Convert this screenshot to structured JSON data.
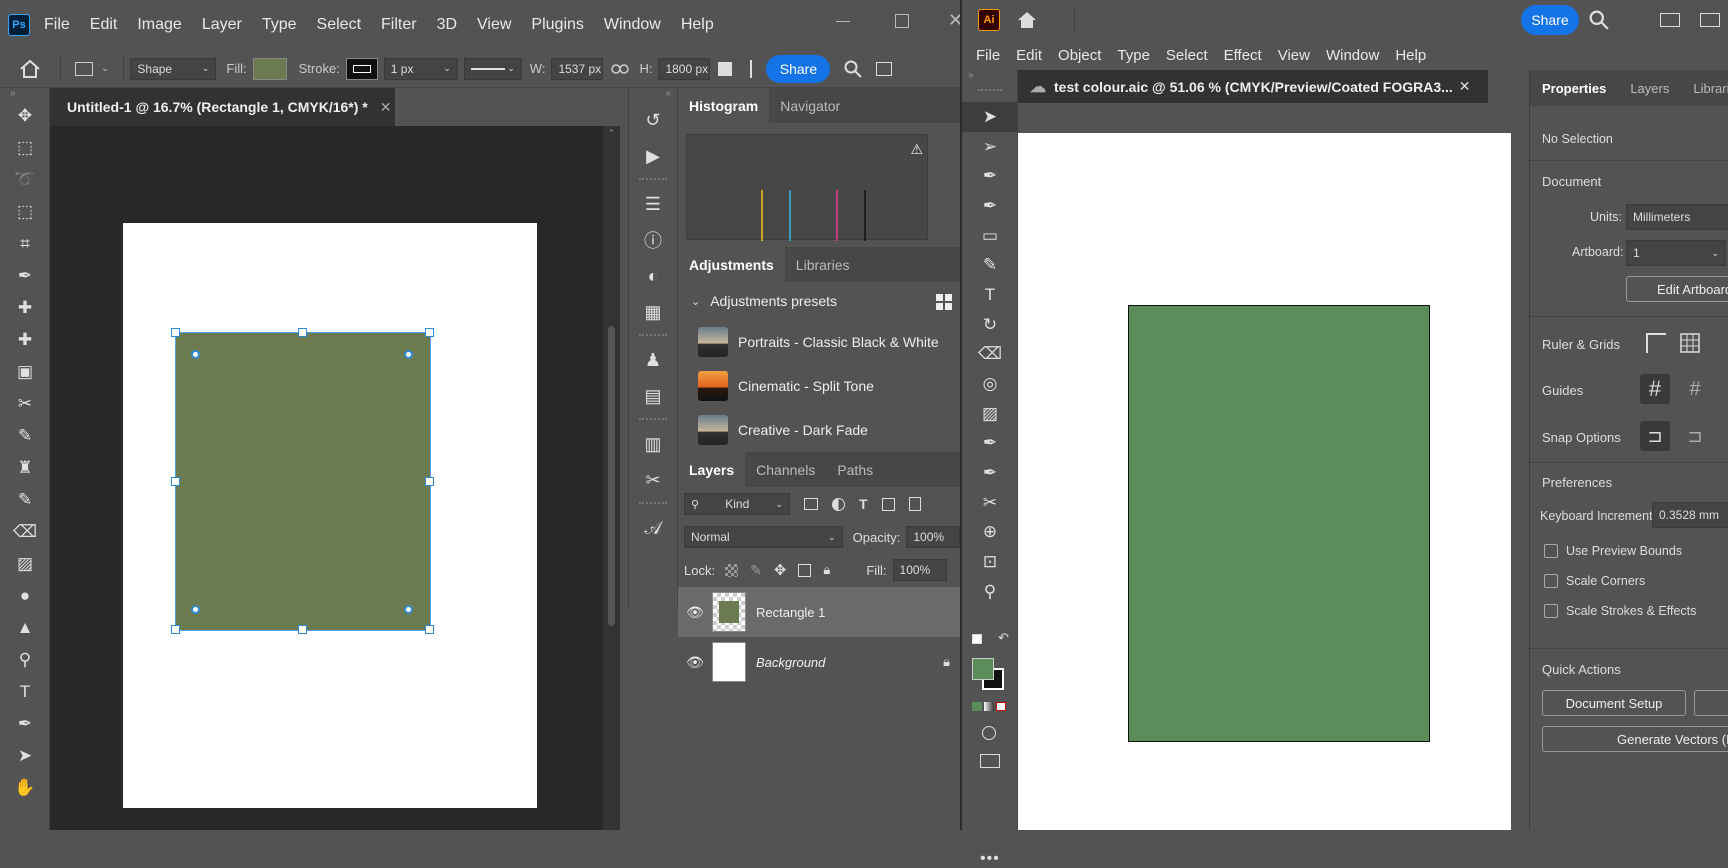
{
  "colors": {
    "ps_fill": "#6b7a4f",
    "ai_fill": "#5a8d5a",
    "accent": "#1473e6",
    "selection": "#2f8ad6",
    "ps_logo": "#31a8ff",
    "ai_logo": "#ff9a00"
  },
  "photoshop": {
    "logo": "Ps",
    "menu": [
      "File",
      "Edit",
      "Image",
      "Layer",
      "Type",
      "Select",
      "Filter",
      "3D",
      "View",
      "Plugins",
      "Window",
      "Help"
    ],
    "options": {
      "mode": "Shape",
      "fill_label": "Fill:",
      "stroke_label": "Stroke:",
      "stroke_width": "1 px",
      "w_label": "W:",
      "w_value": "1537 px",
      "h_label": "H:",
      "h_value": "1800 px",
      "share": "Share"
    },
    "tools": [
      "move-tool-icon",
      "marquee-tool-icon",
      "lasso-tool-icon",
      "object-select-icon",
      "crop-tool-icon",
      "eyedropper-icon",
      "spot-heal-icon",
      "bandage-icon",
      "frame-tool-icon",
      "puppet-warp-icon",
      "brush-tool-icon",
      "stamp-tool-icon",
      "history-brush-icon",
      "eraser-tool-icon",
      "gradient-tool-icon",
      "blur-tool-icon",
      "sharpen-tool-icon",
      "dodge-tool-icon",
      "type-tool-icon",
      "pen-tool-icon",
      "path-select-icon",
      "hand-tool-icon"
    ],
    "document_tab": "Untitled-1 @ 16.7% (Rectangle 1, CMYK/16*) *",
    "panels": {
      "top_tabs": [
        "Histogram",
        "Navigator"
      ],
      "histogram_channels": [
        "#f5c518",
        "#35b3e8",
        "#e83a8e",
        "#111111"
      ],
      "adjust_tabs": [
        "Adjustments",
        "Libraries"
      ],
      "presets_header": "Adjustments presets",
      "presets": [
        "Portraits - Classic Black  &  White",
        "Cinematic - Split Tone",
        "Creative - Dark Fade"
      ],
      "layer_tabs": [
        "Layers",
        "Channels",
        "Paths"
      ],
      "filter_kind": "Kind",
      "blend_mode": "Normal",
      "opacity_label": "Opacity:",
      "opacity_value": "100%",
      "lock_label": "Lock:",
      "fill_label": "Fill:",
      "fill_value": "100%",
      "layers": [
        {
          "name": "Rectangle 1",
          "selected": true
        },
        {
          "name": "Background",
          "selected": false
        }
      ]
    }
  },
  "illustrator": {
    "logo": "Ai",
    "share": "Share",
    "menu": [
      "File",
      "Edit",
      "Object",
      "Type",
      "Select",
      "Effect",
      "View",
      "Window",
      "Help"
    ],
    "document_tab": "test colour.aic @ 51.06 % (CMYK/Preview/Coated FOGRA3...",
    "tools": [
      "selection-tool-icon",
      "direct-select-icon",
      "pen-tool-icon",
      "curvature-tool-icon",
      "rectangle-tool-icon",
      "paintbrush-tool-icon",
      "type-tool-icon",
      "rotate-tool-icon",
      "eraser-tool-icon",
      "warp-tool-icon",
      "gradient-tool-icon",
      "eyedropper-tool-icon",
      "eyedropper-tool-icon",
      "puppet-warp-icon",
      "shape-builder-icon",
      "artboard-tool-icon",
      "zoom-tool-icon"
    ],
    "properties": {
      "tabs": [
        "Properties",
        "Layers",
        "Libraries"
      ],
      "selection": "No Selection",
      "document_header": "Document",
      "units_label": "Units:",
      "units_value": "Millimeters",
      "artboard_label": "Artboard:",
      "artboard_value": "1",
      "edit_artboards": "Edit Artboards",
      "ruler_grids": "Ruler & Grids",
      "guides": "Guides",
      "snap_options": "Snap Options",
      "preferences": "Preferences",
      "keyboard_increment_label": "Keyboard Increment:",
      "keyboard_increment_value": "0.3528 mm",
      "checkboxes": [
        "Use Preview Bounds",
        "Scale Corners",
        "Scale Strokes & Effects"
      ],
      "quick_actions": "Quick Actions",
      "document_setup": "Document Setup",
      "generate_vectors": "Generate Vectors (Beta)"
    }
  }
}
